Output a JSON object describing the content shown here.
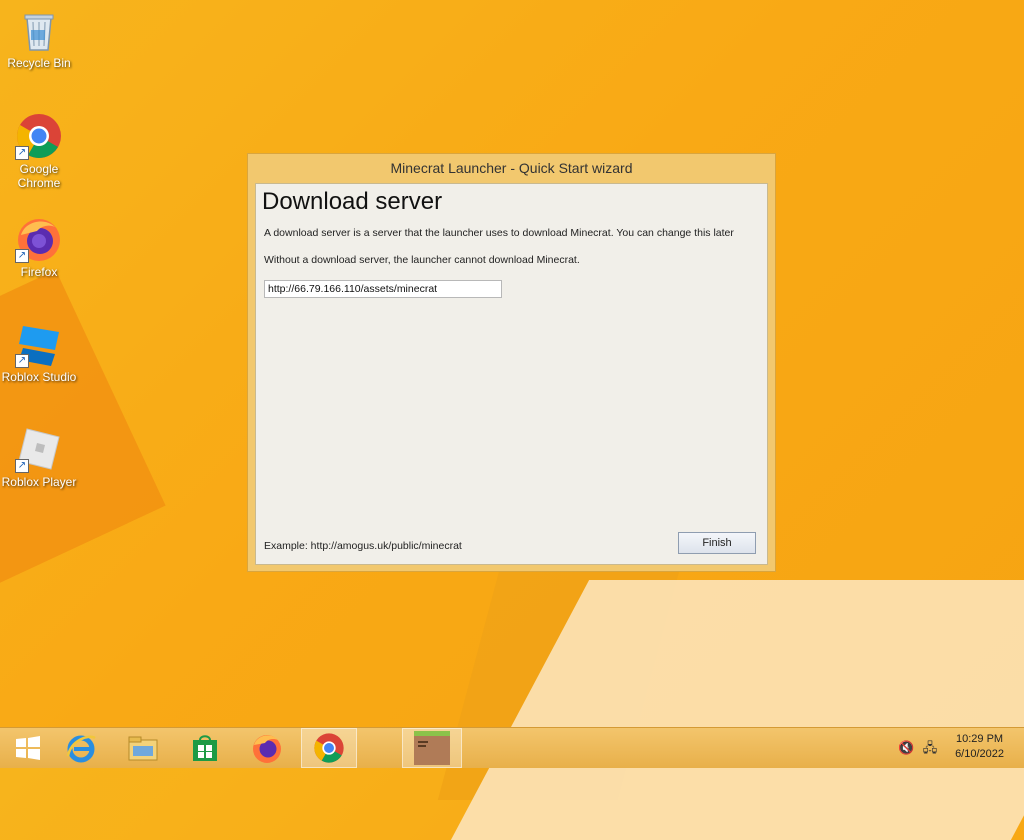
{
  "desktop": {
    "icons": [
      {
        "label": "Recycle Bin",
        "icon": "recycle-bin-icon"
      },
      {
        "label": "Google Chrome",
        "icon": "chrome-icon"
      },
      {
        "label": "Firefox",
        "icon": "firefox-icon"
      },
      {
        "label": "Roblox Studio",
        "icon": "roblox-studio-icon"
      },
      {
        "label": "Roblox Player",
        "icon": "roblox-player-icon"
      }
    ]
  },
  "wizard": {
    "title": "Minecrat Launcher - Quick Start wizard",
    "heading": "Download server",
    "description1": "A download server is a server that the launcher uses to download Minecrat. You can change this later",
    "description2": "Without a download server, the launcher cannot download Minecrat.",
    "url_value": "http://66.79.166.110/assets/minecrat",
    "example": "Example: http://amogus.uk/public/minecrat",
    "finish_label": "Finish"
  },
  "taskbar": {
    "items": [
      "start-icon",
      "internet-explorer-icon",
      "file-explorer-icon",
      "store-icon",
      "firefox-icon",
      "chrome-icon",
      "minecrat-launcher-icon"
    ],
    "active": "chrome-icon",
    "clock_time": "10:29 PM",
    "clock_date": "6/10/2022"
  },
  "colors": {
    "wallpaper": "#f7b41c",
    "window_frame": "#f2c86e",
    "taskbar": "#eebb5a"
  }
}
